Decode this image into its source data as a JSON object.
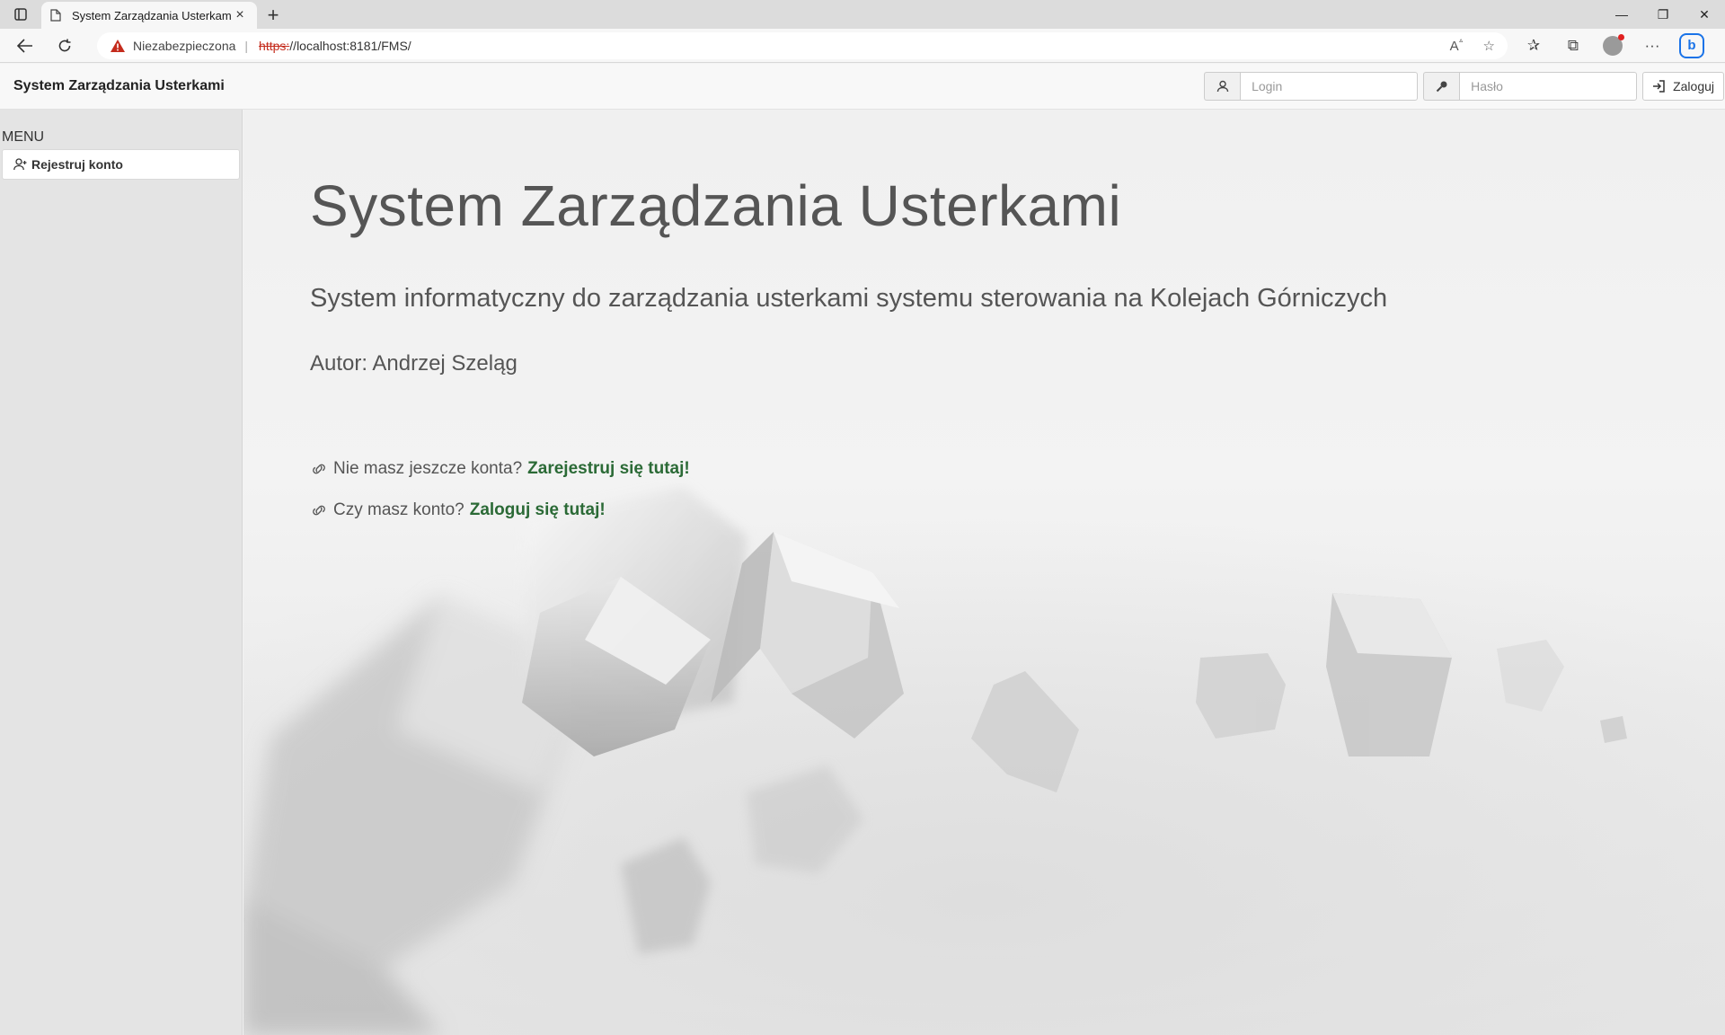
{
  "browser": {
    "tab_title": "System Zarządzania Usterkami",
    "security_label": "Niezabezpieczona",
    "url_protocol": "https:",
    "url_rest": "//localhost:8181/FMS/",
    "new_tab_symbol": "+",
    "close_tab_symbol": "×",
    "window_controls": [
      "—",
      "❐",
      "✕"
    ]
  },
  "header": {
    "brand": "System Zarządzania Usterkami",
    "login_placeholder": "Login",
    "password_placeholder": "Hasło",
    "login_button": "Zaloguj"
  },
  "sidebar": {
    "menu_label": "MENU",
    "items": [
      {
        "label": "Rejestruj konto",
        "icon": "user-icon"
      }
    ]
  },
  "main": {
    "title": "System Zarządzania Usterkami",
    "subtitle": "System informatyczny do zarządzania usterkami systemu sterowania na Kolejach Górniczych",
    "author": "Autor: Andrzej Szeląg",
    "register_prompt": "Nie masz jeszcze konta?",
    "register_link": "Zarejestruj się tutaj!",
    "login_prompt": "Czy masz konto?",
    "login_link": "Zaloguj się tutaj!"
  },
  "colors": {
    "link_green": "#2b6a36",
    "warning_red": "#c42b1c",
    "sidebar_bg": "#e4e4e4"
  }
}
